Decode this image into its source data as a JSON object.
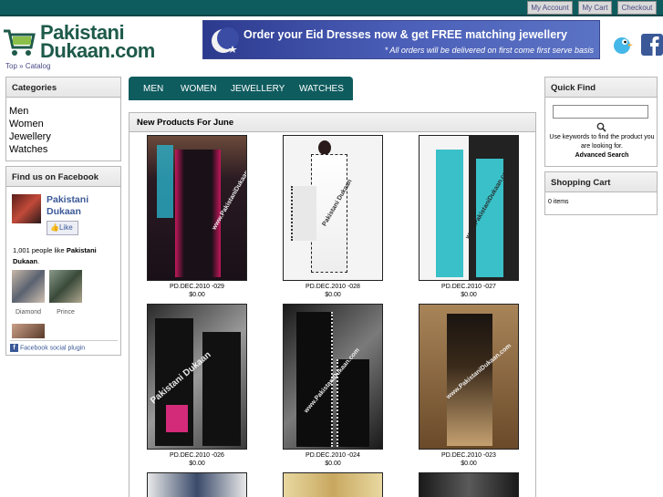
{
  "topbar": {
    "links": [
      {
        "label": "My Account"
      },
      {
        "label": "My Cart"
      },
      {
        "label": "Checkout"
      }
    ]
  },
  "logo": {
    "line1": "Pakistani",
    "line2": "Dukaan.com"
  },
  "banner": {
    "headline": "Order your Eid Dresses now & get FREE matching jewellery",
    "subline": "* All orders will be delivered on first come first serve basis"
  },
  "breadcrumb": {
    "top": "Top",
    "sep": "»",
    "catalog": "Catalog"
  },
  "categories": {
    "title": "Categories",
    "items": [
      "Men",
      "Women",
      "Jewellery",
      "Watches"
    ]
  },
  "facebook": {
    "title": "Find us on Facebook",
    "page_name_1": "Pakistani",
    "page_name_2": "Dukaan",
    "like": "Like",
    "likes_prefix": "1,001 people like",
    "likes_page": "Pakistani Dukaan",
    "fans": [
      "Diamond",
      "Prince"
    ],
    "plugin": "Facebook social plugin"
  },
  "nav": [
    "MEN",
    "WOMEN",
    "JEWELLERY",
    "WATCHES"
  ],
  "products": {
    "title": "New Products For June",
    "items": [
      {
        "name": "PD.DEC.2010 -029",
        "price": "$0.00"
      },
      {
        "name": "PD.DEC.2010 -028",
        "price": "$0.00"
      },
      {
        "name": "PD.DEC.2010 -027",
        "price": "$0.00"
      },
      {
        "name": "PD.DEC.2010 -026",
        "price": "$0.00"
      },
      {
        "name": "PD.DEC.2010 -024",
        "price": "$0.00"
      },
      {
        "name": "PD.DEC.2010 -023",
        "price": "$0.00"
      }
    ],
    "watermark": "Pakistani Dukaan",
    "watermark_url": "www.PakistaniDukaan.com"
  },
  "quickfind": {
    "title": "Quick Find",
    "help": "Use keywords to find the product you are looking for.",
    "advanced": "Advanced Search"
  },
  "cart": {
    "title": "Shopping Cart",
    "items": "0 items"
  }
}
